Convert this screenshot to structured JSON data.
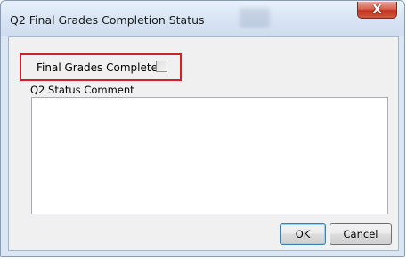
{
  "window": {
    "title": "Q2 Final Grades Completion Status",
    "close_glyph": "X",
    "close_icon": "close-icon"
  },
  "form": {
    "final_grades_label": "Final Grades Complete:",
    "final_grades_checked": false,
    "comment_label": "Q2 Status Comment",
    "comment_value": ""
  },
  "buttons": {
    "ok_label": "OK",
    "cancel_label": "Cancel"
  },
  "colors": {
    "highlight_border": "#d21f26",
    "close_button": "#c2321c",
    "title_bar": "#d6e3f3"
  }
}
